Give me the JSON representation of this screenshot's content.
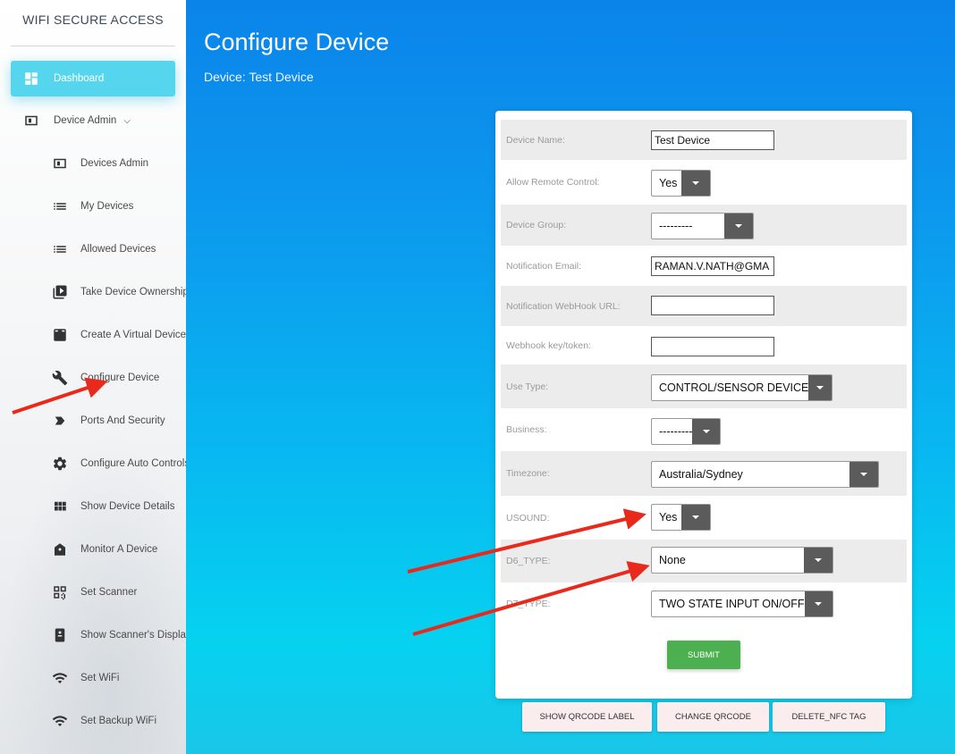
{
  "brand": "WIFI SECURE ACCESS",
  "sidebar": {
    "items": [
      {
        "label": "Dashboard"
      },
      {
        "label": "Device Admin"
      },
      {
        "label": "Devices Admin"
      },
      {
        "label": "My Devices"
      },
      {
        "label": "Allowed Devices"
      },
      {
        "label": "Take Device Ownership"
      },
      {
        "label": "Create A Virtual Device"
      },
      {
        "label": "Configure Device"
      },
      {
        "label": "Ports And Security"
      },
      {
        "label": "Configure Auto Controls"
      },
      {
        "label": "Show Device Details"
      },
      {
        "label": "Monitor A Device"
      },
      {
        "label": "Set Scanner"
      },
      {
        "label": "Show Scanner's Display"
      },
      {
        "label": "Set WiFi"
      },
      {
        "label": "Set Backup WiFi"
      }
    ]
  },
  "header": {
    "title": "Configure Device",
    "subtitle": "Device: Test Device"
  },
  "form": {
    "device_name": {
      "label": "Device Name:",
      "value": "Test Device"
    },
    "allow_remote": {
      "label": "Allow Remote Control:",
      "value": "Yes"
    },
    "device_group": {
      "label": "Device Group:",
      "value": "---------"
    },
    "notification_email": {
      "label": "Notification Email:",
      "value": "RAMAN.V.NATH@GMA"
    },
    "webhook_url": {
      "label": "Notification WebHook URL:",
      "value": ""
    },
    "webhook_key": {
      "label": "Webhook key/token:",
      "value": ""
    },
    "use_type": {
      "label": "Use Type:",
      "value": "CONTROL/SENSOR DEVICE"
    },
    "business": {
      "label": "Business:",
      "value": "---------"
    },
    "timezone": {
      "label": "Timezone:",
      "value": "Australia/Sydney"
    },
    "usound": {
      "label": "USOUND:",
      "value": "Yes"
    },
    "d6_type": {
      "label": "D6_TYPE:",
      "value": "None"
    },
    "d7_type": {
      "label": "D7_TYPE:",
      "value": "TWO STATE INPUT ON/OFF"
    },
    "submit_label": "SUBMIT"
  },
  "actions": {
    "show_qrcode": "SHOW QRCODE LABEL",
    "change_qrcode": "CHANGE QRCODE",
    "delete_nfc": "DELETE_NFC TAG"
  },
  "colors": {
    "accent": "#56d6ee",
    "submit": "#4caf50",
    "annotation_arrow": "#e8291c"
  }
}
